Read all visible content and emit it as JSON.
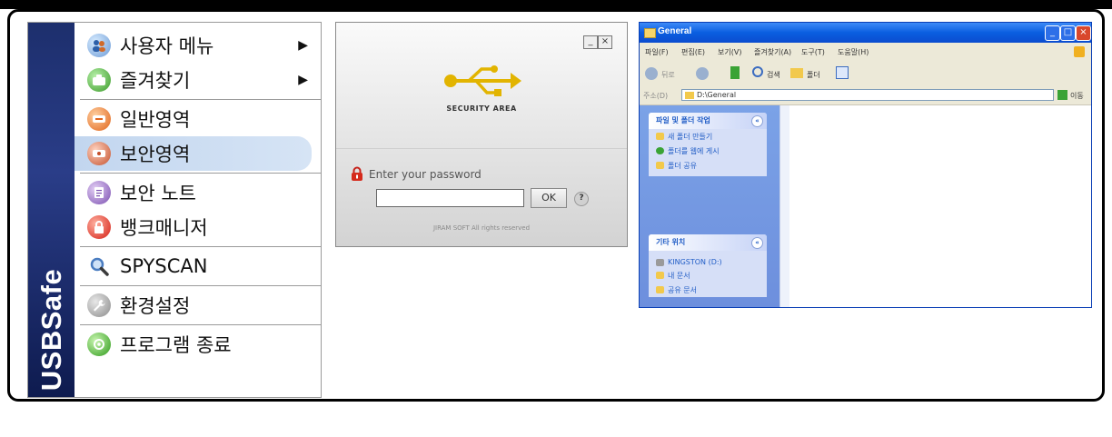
{
  "start_menu": {
    "brand": "USBSafe",
    "items": [
      {
        "label": "사용자 메뉴",
        "icon": "user-menu-icon",
        "submenu": true
      },
      {
        "label": "즐겨찾기",
        "icon": "favorites-icon",
        "submenu": true
      },
      {
        "label": "일반영역",
        "icon": "general-area-icon"
      },
      {
        "label": "보안영역",
        "icon": "secure-area-icon",
        "highlighted": true
      },
      {
        "label": "보안 노트",
        "icon": "secure-note-icon"
      },
      {
        "label": "뱅크매니저",
        "icon": "bank-manager-icon"
      },
      {
        "label": "SPYSCAN",
        "icon": "magnifier-icon"
      },
      {
        "label": "환경설정",
        "icon": "settings-icon"
      },
      {
        "label": "프로그램 종료",
        "icon": "power-icon"
      }
    ],
    "submenu_arrow": "▶"
  },
  "login_panel": {
    "logo_text": "SECURITY AREA",
    "password_label": "Enter your password",
    "ok_label": "OK",
    "help_label": "?",
    "copyright": "JIRAM SOFT All rights reserved",
    "minimize_label": "_",
    "close_label": "×"
  },
  "explorer": {
    "title": "General",
    "menu": [
      "파일(F)",
      "편집(E)",
      "보기(V)",
      "즐겨찾기(A)",
      "도구(T)",
      "도움말(H)"
    ],
    "toolbar": {
      "back": "뒤로",
      "search": "검색",
      "folders": "폴더"
    },
    "address_label": "주소(D)",
    "address": "D:\\General",
    "go_label": "이동",
    "tasks_title": "파일 및 폴더 작업",
    "tasks": [
      "새 폴더 만들기",
      "폴더를 웹에 게시",
      "폴더 공유"
    ],
    "places_title": "기타 위치",
    "places": [
      "KINGSTON (D:)",
      "내 문서",
      "공유 문서"
    ],
    "colors": {
      "title": "#0a5ee0",
      "pane": "#7ba2e7"
    }
  }
}
